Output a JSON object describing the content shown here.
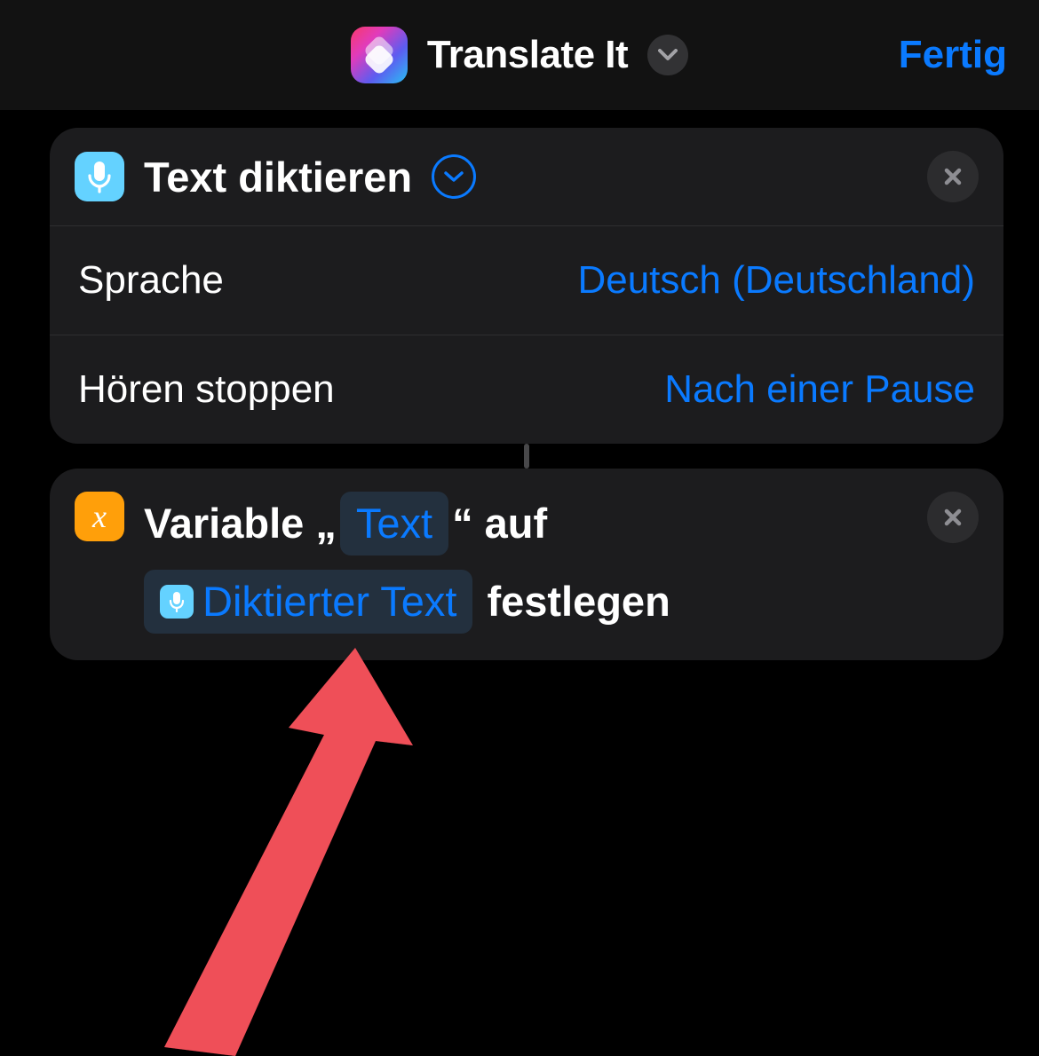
{
  "header": {
    "title": "Translate It",
    "done_label": "Fertig"
  },
  "actions": [
    {
      "title": "Text diktieren",
      "params": [
        {
          "label": "Sprache",
          "value": "Deutsch (Deutschland)"
        },
        {
          "label": "Hören stoppen",
          "value": "Nach einer Pause"
        }
      ]
    },
    {
      "text_parts": {
        "prefix": "Variable „",
        "token1": "Text",
        "mid": "“ auf",
        "token2": "Diktierter Text",
        "suffix": "festlegen"
      }
    }
  ],
  "icons": {
    "mic": "microphone-icon",
    "variable": "x"
  },
  "colors": {
    "accent": "#0a7aff",
    "card_bg": "#1c1c1e",
    "mic_bg": "#64d2ff",
    "var_bg": "#ff9f0a"
  }
}
